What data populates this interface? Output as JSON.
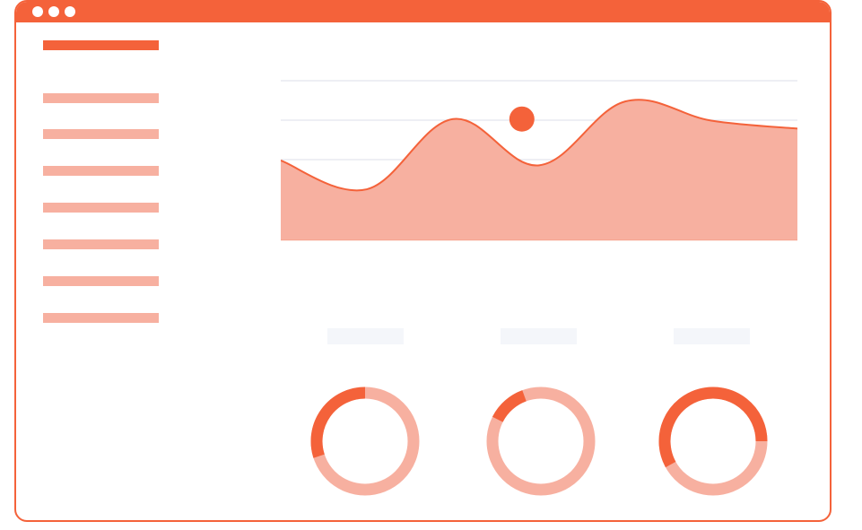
{
  "colors": {
    "accent": "#f4623a",
    "accent_light": "#f7b0a0",
    "gridline": "#e8eaf0",
    "placeholder": "#f4f6fa"
  },
  "window": {
    "titlebar_dots": [
      "window-dot",
      "window-dot",
      "window-dot"
    ]
  },
  "sidebar": {
    "header_active": true,
    "item_count": 7
  },
  "chart_data": {
    "type": "area",
    "xlabel": "",
    "ylabel": "",
    "grid": true,
    "legend": "none",
    "x": [
      0,
      1,
      2,
      3,
      4,
      5,
      6
    ],
    "y": [
      50,
      32,
      76,
      47,
      87,
      75,
      70
    ],
    "ylim": [
      0,
      100
    ],
    "highlight": {
      "x": 2.8,
      "y": 76
    }
  },
  "donuts": [
    {
      "name": "donut-1",
      "fraction": 0.3
    },
    {
      "name": "donut-2",
      "fraction": 0.12
    },
    {
      "name": "donut-3",
      "fraction": 0.58
    }
  ]
}
